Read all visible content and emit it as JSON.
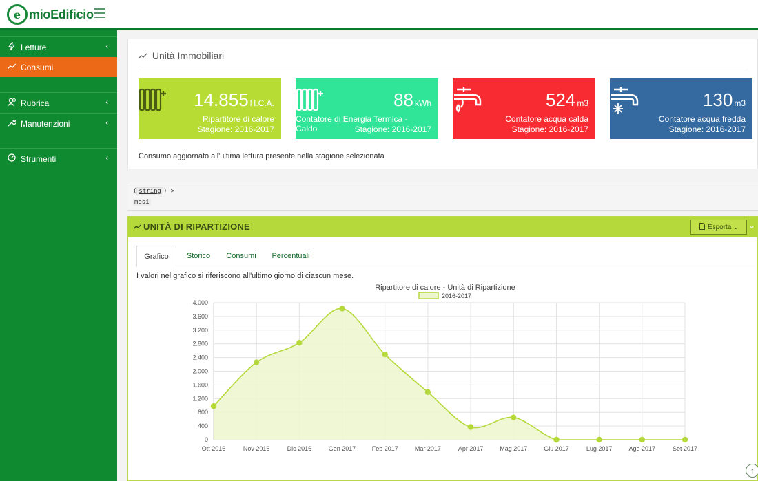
{
  "app": {
    "logo_mark": "e",
    "logo_text": "mioEdificio"
  },
  "sidebar": {
    "items": [
      {
        "label": "Letture",
        "icon": "bolt-icon"
      },
      {
        "label": "Consumi",
        "icon": "line-chart-icon"
      },
      {
        "label": "Rubrica",
        "icon": "users-icon"
      },
      {
        "label": "Manutenzioni",
        "icon": "wrench-icon"
      },
      {
        "label": "Strumenti",
        "icon": "dashboard-icon"
      }
    ]
  },
  "summary": {
    "title": "Unità Immobiliari",
    "note": "Consumo aggiornato all'ultima lettura presente nella stagione selezionata",
    "tiles": [
      {
        "value": "14.855",
        "unit": "H.C.A.",
        "line1": "Ripartitore di calore",
        "line2": "Stagione: 2016-2017",
        "color": "#b7dd35",
        "icon": "radiator-icon"
      },
      {
        "value": "88",
        "unit": "kWh",
        "line1": "Contatore di Energia Termica - Caldo",
        "line2": "Stagione: 2016-2017",
        "color": "#30e598",
        "icon": "radiator-icon"
      },
      {
        "value": "524",
        "unit": "m3",
        "line1": "Contatore acqua calda",
        "line2": "Stagione: 2016-2017",
        "color": "#f82b32",
        "icon": "hot-water-tap-icon"
      },
      {
        "value": "130",
        "unit": "m3",
        "line1": "Contatore acqua fredda",
        "line2": "Stagione: 2016-2017",
        "color": "#356aa0",
        "icon": "cold-water-tap-icon"
      }
    ]
  },
  "debug": {
    "type_token": "string",
    "prefix": "(",
    "suffix": ") >",
    "value": "mesi"
  },
  "panel": {
    "title": "UNITÀ DI RIPARTIZIONE",
    "export_label": "Esporta",
    "tabs": [
      "Grafico",
      "Storico",
      "Consumi",
      "Percentuali"
    ],
    "note": "I valori nel grafico si riferiscono all'ultimo giorno di ciascun mese."
  },
  "colors": {
    "accent_green": "#0f8a30",
    "active_orange": "#ec6a17",
    "lime": "#b5d93a"
  },
  "chart_data": {
    "type": "area",
    "title": "Ripartitore di calore - Unità di Ripartizione",
    "categories": [
      "Ott 2016",
      "Nov 2016",
      "Dic 2016",
      "Gen 2017",
      "Feb 2017",
      "Mar 2017",
      "Apr 2017",
      "Mag 2017",
      "Giu 2017",
      "Lug 2017",
      "Ago 2017",
      "Set 2017"
    ],
    "series": [
      {
        "name": "2016-2017",
        "values": [
          980,
          2260,
          2830,
          3830,
          2490,
          1390,
          370,
          650,
          0,
          0,
          0,
          0
        ]
      }
    ],
    "ylim": [
      0,
      4000
    ],
    "yticks": [
      "0",
      "400",
      "800",
      "1.200",
      "1.600",
      "2.000",
      "2.400",
      "2.800",
      "3.200",
      "3.600",
      "4.000"
    ],
    "ytick_values": [
      0,
      400,
      800,
      1200,
      1600,
      2000,
      2400,
      2800,
      3200,
      3600,
      4000
    ],
    "grid": true,
    "legend": "top-center",
    "line_color": "#b5d93a",
    "fill_color": "#eef6cf"
  }
}
